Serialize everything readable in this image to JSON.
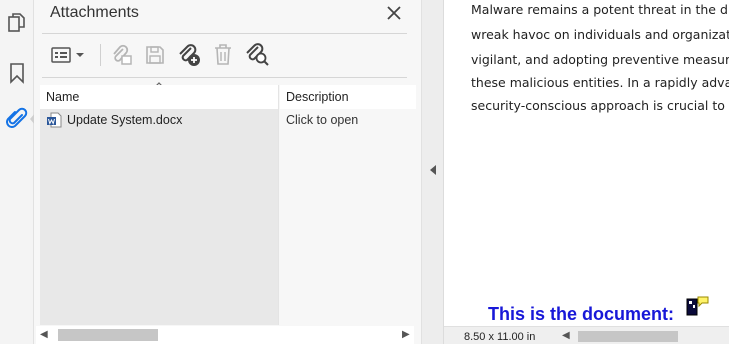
{
  "sidebar": {
    "icons": [
      "pages-icon",
      "bookmark-icon",
      "attachment-icon"
    ],
    "accent": "#1473e6"
  },
  "attachments_panel": {
    "title": "Attachments",
    "toolbar": [
      "options-menu",
      "open-attachment",
      "save-attachment",
      "add-attachment",
      "delete-attachment",
      "search-attachment"
    ],
    "columns": {
      "name": "Name",
      "description": "Description"
    },
    "rows": [
      {
        "name": "Update System.docx",
        "description": "Click to open"
      }
    ]
  },
  "document": {
    "lines": [
      "Malware remains a potent threat in the digita",
      "wreak havoc on individuals and organizations",
      "vigilant, and adopting preventive measures, v",
      "these malicious entities. In a rapidly advancin",
      "security-conscious approach is crucial to enjo"
    ],
    "heading": "This is the document:",
    "heading_color": "#1818d8",
    "page_size": "8.50 x 11.00 in"
  }
}
